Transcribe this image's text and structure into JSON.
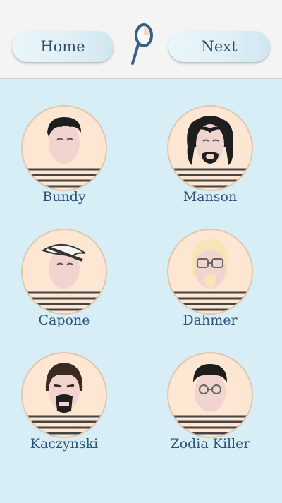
{
  "header": {
    "home_label": "Home",
    "next_label": "Next",
    "logo_icon": "magnifier-logo-icon"
  },
  "suspects": [
    {
      "name": "Bundy",
      "icon": "bundy-portrait-icon"
    },
    {
      "name": "Manson",
      "icon": "manson-portrait-icon"
    },
    {
      "name": "Capone",
      "icon": "capone-portrait-icon"
    },
    {
      "name": "Dahmer",
      "icon": "dahmer-portrait-icon"
    },
    {
      "name": "Kaczynski",
      "icon": "kaczynski-portrait-icon"
    },
    {
      "name": "Zodia Killer",
      "icon": "zodia-killer-portrait-icon"
    }
  ],
  "colors": {
    "background": "#d7eef7",
    "header": "#f4f4f4",
    "text": "#2e5478",
    "portrait_bg": "#fde6d2",
    "skin": "#f1d4cf"
  }
}
